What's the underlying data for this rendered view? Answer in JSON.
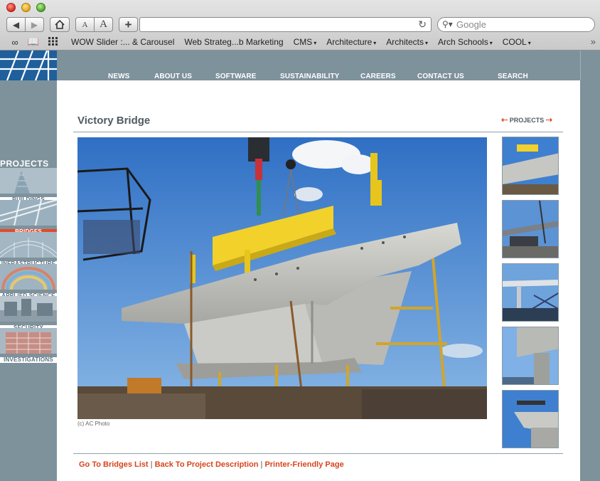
{
  "browser": {
    "search_placeholder": "Google",
    "bookmarks": [
      {
        "label": "WOW Slider :... & Carousel",
        "menu": false
      },
      {
        "label": "Web Strateg...b Marketing",
        "menu": false
      },
      {
        "label": "CMS",
        "menu": true
      },
      {
        "label": "Architecture",
        "menu": true
      },
      {
        "label": "Architects",
        "menu": true
      },
      {
        "label": "Arch Schools",
        "menu": true
      },
      {
        "label": "COOL",
        "menu": true
      }
    ],
    "font_small_label": "A",
    "font_large_label": "A",
    "add_label": "+",
    "more_label": "»",
    "caret": "▾"
  },
  "site": {
    "nav": [
      "NEWS",
      "ABOUT US",
      "SOFTWARE",
      "SUSTAINABILITY",
      "CAREERS",
      "CONTACT US",
      "SEARCH"
    ],
    "sidebar": {
      "heading": "PROJECTS",
      "categories": [
        {
          "label": "BUILDINGS",
          "active": false
        },
        {
          "label": "BRIDGES",
          "active": true
        },
        {
          "label": "INFRASTRUCTURE",
          "active": false
        },
        {
          "label": "APPLIED SCIENCE",
          "active": false
        },
        {
          "label": "SECURITY",
          "active": false
        },
        {
          "label": "INVESTIGATIONS",
          "active": false
        }
      ]
    },
    "page_title": "Victory Bridge",
    "projects_link": "PROJECTS",
    "photo_credit": "(c) AC Photo",
    "footer": {
      "link1": "Go To Bridges List",
      "link2": "Back To Project Description",
      "link3": "Printer-Friendly Page",
      "separator": "|"
    },
    "colors": {
      "accent": "#e24a2c",
      "sidebar": "#7e929c",
      "title": "#505a62"
    }
  }
}
